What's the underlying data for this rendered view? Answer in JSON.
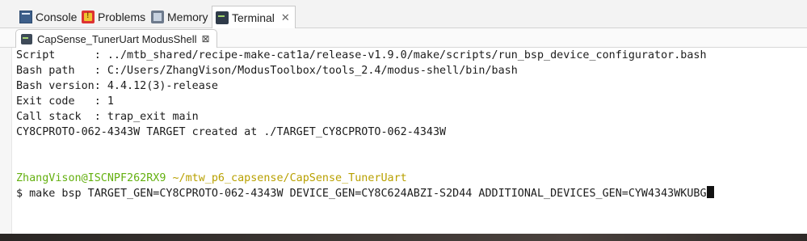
{
  "view_tabs": [
    {
      "label": "Console",
      "icon": "console-icon"
    },
    {
      "label": "Problems",
      "icon": "problems-icon"
    },
    {
      "label": "Memory",
      "icon": "memory-icon"
    },
    {
      "label": "Terminal",
      "icon": "terminal-icon",
      "active": true,
      "close": "✕"
    }
  ],
  "editor_tab": {
    "label": "CapSense_TunerUart ModusShell",
    "close": "⊠"
  },
  "terminal": {
    "lines": [
      "Script      : ../mtb_shared/recipe-make-cat1a/release-v1.9.0/make/scripts/run_bsp_device_configurator.bash",
      "Bash path   : C:/Users/ZhangVison/ModusToolbox/tools_2.4/modus-shell/bin/bash",
      "Bash version: 4.4.12(3)-release",
      "Exit code   : 1",
      "Call stack  : trap_exit main",
      "CY8CPROTO-062-4343W TARGET created at ./TARGET_CY8CPROTO-062-4343W",
      "",
      ""
    ],
    "prompt_user": "ZhangVison@ISCNPF262RX9",
    "prompt_path": "~/mtw_p6_capsense/CapSense_TunerUart",
    "command": "$ make bsp TARGET_GEN=CY8CPROTO-062-4343W DEVICE_GEN=CY8C624ABZI-S2D44 ADDITIONAL_DEVICES_GEN=CYW4343WKUBG"
  },
  "colors": {
    "prompt_user": "#64b010",
    "prompt_path": "#b8a000",
    "text": "#1c1c1c"
  }
}
